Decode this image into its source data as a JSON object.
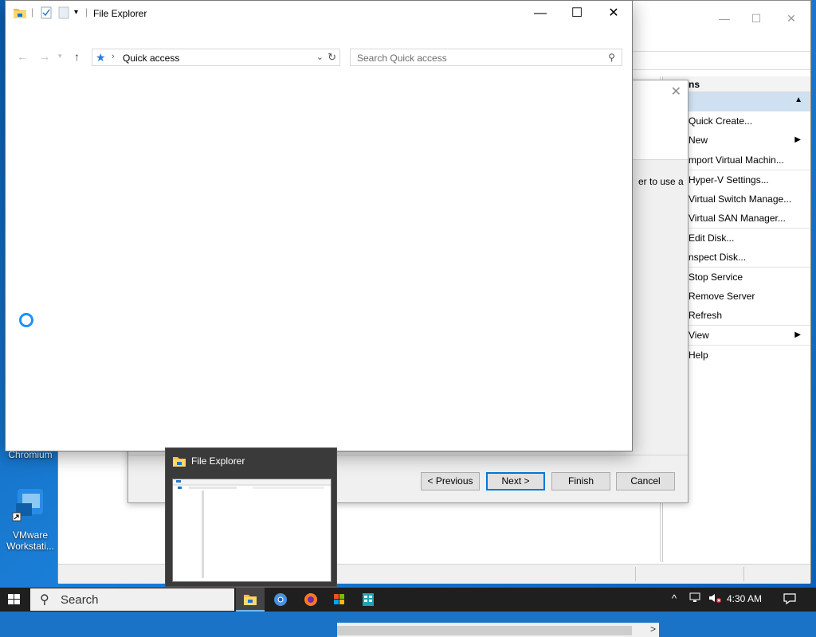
{
  "desktop": {
    "icons": [
      {
        "label": "Chromium"
      },
      {
        "label": "VMware\nWorkstati..."
      }
    ]
  },
  "hyperv": {
    "actions_header": "ns",
    "actions": [
      {
        "label": "Quick Create...",
        "submenu": false
      },
      {
        "label": "New",
        "submenu": true
      },
      {
        "label": "mport Virtual Machin...",
        "submenu": false
      },
      {
        "label": "Hyper-V Settings...",
        "submenu": false,
        "sep": true
      },
      {
        "label": "Virtual Switch Manage...",
        "submenu": false
      },
      {
        "label": "Virtual SAN Manager...",
        "submenu": false
      },
      {
        "label": "Edit Disk...",
        "submenu": false,
        "sep": true
      },
      {
        "label": "nspect Disk...",
        "submenu": false
      },
      {
        "label": "Stop Service",
        "submenu": false,
        "sep": true
      },
      {
        "label": "Remove Server",
        "submenu": false
      },
      {
        "label": "Refresh",
        "submenu": false
      },
      {
        "label": "View",
        "submenu": true,
        "sep": true
      },
      {
        "label": "Help",
        "submenu": false
      }
    ]
  },
  "wizard": {
    "partial_text": "er to use a",
    "buttons": {
      "previous": "< Previous",
      "next": "Next >",
      "finish": "Finish",
      "cancel": "Cancel"
    }
  },
  "explorer": {
    "title": "File Explorer",
    "address": "Quick access",
    "search_placeholder": "Search Quick access"
  },
  "preview": {
    "title": "File Explorer"
  },
  "taskbar": {
    "search_label": "Search",
    "clock": "4:30 AM"
  }
}
